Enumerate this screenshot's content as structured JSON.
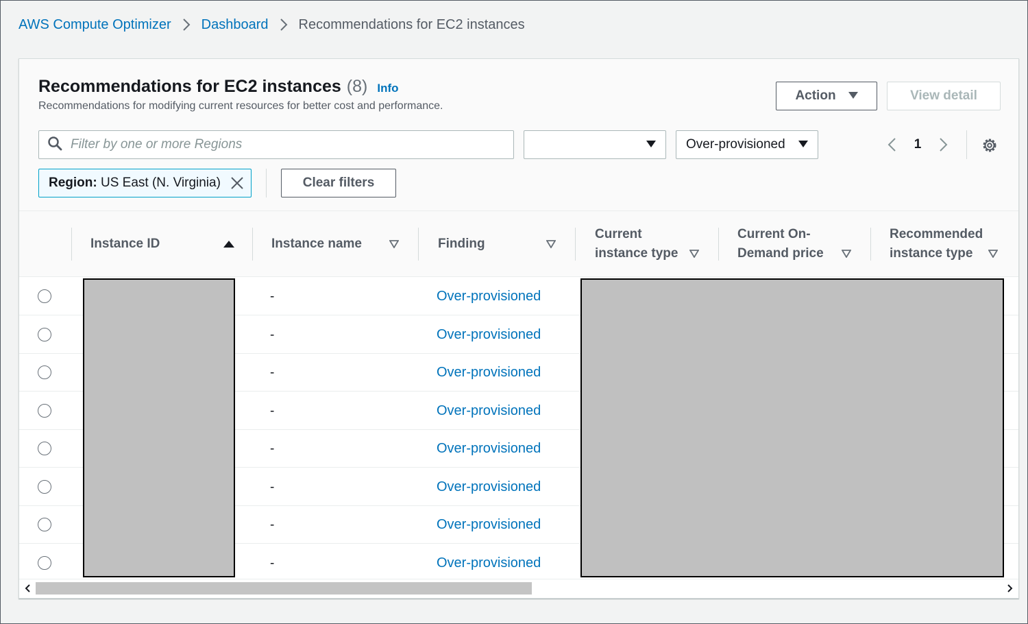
{
  "breadcrumb": {
    "items": [
      "AWS Compute Optimizer",
      "Dashboard"
    ],
    "current": "Recommendations for EC2 instances"
  },
  "header": {
    "title": "Recommendations for EC2 instances",
    "count": "(8)",
    "info": "Info",
    "description": "Recommendations for modifying current resources for better cost and performance."
  },
  "actions": {
    "action_label": "Action",
    "view_detail_label": "View detail"
  },
  "filters": {
    "search_placeholder": "Filter by one or more Regions",
    "select1_value": "",
    "select2_value": "Over-provisioned",
    "token_key": "Region:",
    "token_value": "US East (N. Virginia)",
    "clear_label": "Clear filters"
  },
  "pagination": {
    "page": "1"
  },
  "table": {
    "columns": [
      {
        "line1": "Instance ID",
        "line2": ""
      },
      {
        "line1": "Instance name",
        "line2": ""
      },
      {
        "line1": "Finding",
        "line2": ""
      },
      {
        "line1": "Current",
        "line2": "instance type"
      },
      {
        "line1": "Current On-",
        "line2": "Demand price"
      },
      {
        "line1": "Recommended",
        "line2": "instance type"
      }
    ],
    "rows": [
      {
        "name": "-",
        "finding": "Over-provisioned"
      },
      {
        "name": "-",
        "finding": "Over-provisioned"
      },
      {
        "name": "-",
        "finding": "Over-provisioned"
      },
      {
        "name": "-",
        "finding": "Over-provisioned"
      },
      {
        "name": "-",
        "finding": "Over-provisioned"
      },
      {
        "name": "-",
        "finding": "Over-provisioned"
      },
      {
        "name": "-",
        "finding": "Over-provisioned"
      },
      {
        "name": "-",
        "finding": "Over-provisioned"
      }
    ]
  },
  "colors": {
    "link": "#0073bb",
    "background": "#f2f3f3",
    "redaction": "#c0c0c0",
    "token_border": "#00a1c9"
  }
}
